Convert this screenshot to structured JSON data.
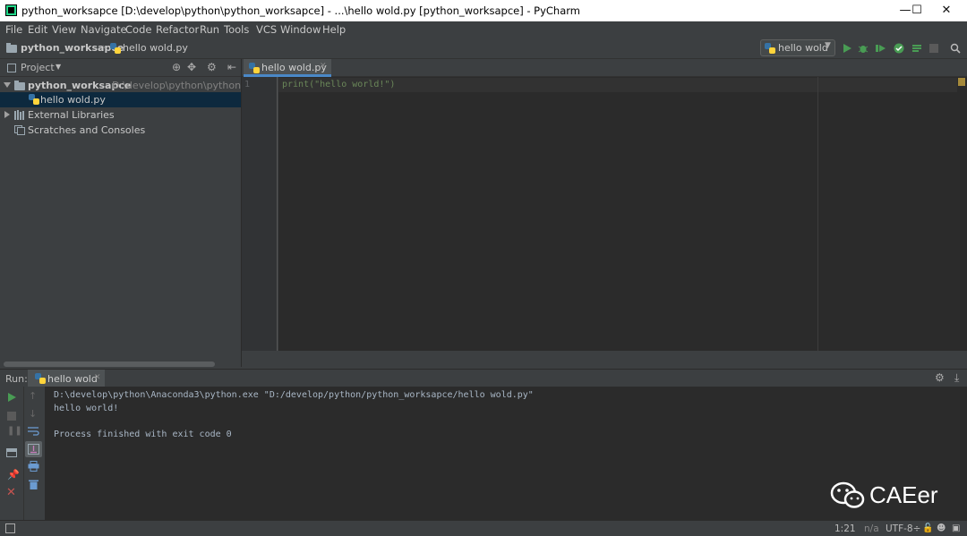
{
  "window": {
    "title": "python_worksapce [D:\\develop\\python\\python_worksapce] - ...\\hello wold.py [python_worksapce] - PyCharm",
    "minimize": "—",
    "maximize": "☐",
    "close": "✕"
  },
  "menu": [
    "File",
    "Edit",
    "View",
    "Navigate",
    "Code",
    "Refactor",
    "Run",
    "Tools",
    "VCS",
    "Window",
    "Help"
  ],
  "navbar": {
    "project": "python_worksapce",
    "file": "hello wold.py",
    "run_config": "hello wold"
  },
  "project_panel": {
    "title": "Project",
    "root_name": "python_worksapce",
    "root_path": "D:\\develop\\python\\python_wor",
    "file": "hello wold.py",
    "external": "External Libraries",
    "scratches": "Scratches and Consoles"
  },
  "editor": {
    "tab": "hello wold.py",
    "line_number": "1",
    "code": "print(\"hello world!\")"
  },
  "run_panel": {
    "label": "Run:",
    "tab": "hello wold",
    "lines": [
      "D:\\develop\\python\\Anaconda3\\python.exe \"D:/develop/python/python_worksapce/hello wold.py\"",
      "hello world!",
      "",
      "Process finished with exit code 0"
    ]
  },
  "status": {
    "position": "1:21",
    "line_sep": "n/a",
    "encoding": "UTF-8÷"
  },
  "watermark": {
    "text": "CAEer"
  },
  "colors": {
    "accent": "#4a88c7",
    "run_green": "#499c54",
    "stop_red": "#c75450",
    "string": "#6a8759"
  }
}
